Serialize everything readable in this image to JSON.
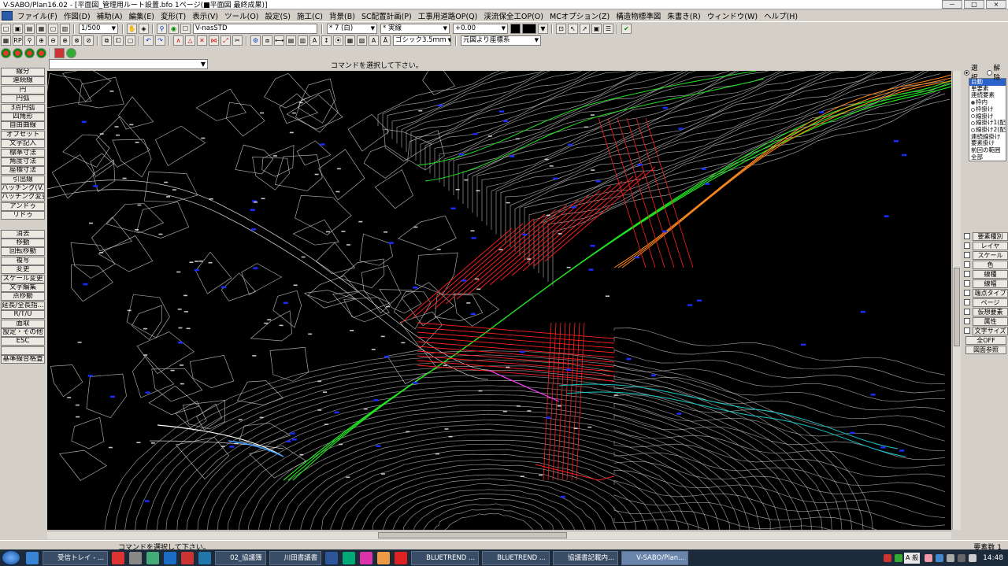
{
  "window": {
    "title": "V-SABO/Plan16.02 - [平面図_管理用ルート設置.bfo 1ページ(■平面図 最終成果)]",
    "controls": [
      "－",
      "□",
      "×"
    ]
  },
  "menubar": {
    "items": [
      "ファイル(F)",
      "作図(D)",
      "補助(A)",
      "編集(E)",
      "変形(T)",
      "表示(V)",
      "ツール(O)",
      "設定(S)",
      "施工(C)",
      "背景(B)",
      "SC配置計画(P)",
      "工事用道路OP(Q)",
      "渓流保全工OP(O)",
      "MCオプション(Z)",
      "構造物標準図",
      "朱書き(R)",
      "ウィンドウ(W)",
      "ヘルプ(H)"
    ]
  },
  "toolbar1": {
    "scale": "1/500",
    "layer_style": "V-nasSTD",
    "line_weight": "* 7 (白)",
    "line_type": "* 実線",
    "offset": "+0.00"
  },
  "toolbar2": {
    "font": "ゴシック3.5ｍｍ",
    "coordinate_system": "元図より座標系"
  },
  "command_bar": {
    "combo_value": "",
    "message": "コマンドを選択して下さい。"
  },
  "left_tools": {
    "group1": [
      "線分",
      "連続線",
      "円",
      "円弧",
      "3点円弧",
      "四角形",
      "自由曲線",
      "オフセット",
      "文字記入",
      "標準寸法",
      "角度寸法",
      "座標寸法",
      "引出線",
      "ハッチング(V...",
      "ハッチング変更",
      "アンドゥ",
      "リドゥ"
    ],
    "group2": [
      "消去",
      "移動",
      "回転移動",
      "複写",
      "変更",
      "スケール変更",
      "文字編集",
      "点移動",
      "延長/全長指...",
      "R/T/U",
      "面取",
      "設定・その他",
      "ESC",
      "",
      "基準線合格査"
    ]
  },
  "right_panel": {
    "mode_options": [
      {
        "label": "選択",
        "checked": true
      },
      {
        "label": "解除",
        "checked": false
      }
    ],
    "select_items": [
      {
        "label": "自動",
        "highlight": true,
        "radio": null
      },
      {
        "label": "単要素",
        "highlight": false,
        "radio": null
      },
      {
        "label": "連続要素",
        "highlight": false,
        "radio": null
      },
      {
        "label": "枠内",
        "highlight": false,
        "radio": true
      },
      {
        "label": "枠掛け",
        "highlight": false,
        "radio": false
      },
      {
        "label": "線掛け",
        "highlight": false,
        "radio": false
      },
      {
        "label": "線掛け1(配置多",
        "highlight": false,
        "radio": false
      },
      {
        "label": "線掛け2(配置多",
        "highlight": false,
        "radio": false
      },
      {
        "label": "連続線掛け",
        "highlight": false,
        "radio": null
      },
      {
        "label": "要素掛け",
        "highlight": false,
        "radio": null
      },
      {
        "label": "前回の範囲",
        "highlight": false,
        "radio": null
      },
      {
        "label": "全部",
        "highlight": false,
        "radio": null
      }
    ],
    "attributes": [
      "要素種別",
      "レイヤ",
      "スケール",
      "色",
      "線種",
      "線幅",
      "端点タイプ",
      "ページ",
      "仮想要素",
      "属性",
      "文字サイズ"
    ],
    "buttons": [
      "全OFF",
      "図面参照"
    ]
  },
  "status": {
    "message": "コマンドを選択して下さい。",
    "count": "要素数  1"
  },
  "taskbar": {
    "tasks": [
      {
        "label": "受信トレイ - ...",
        "color": "#2a6ac7"
      },
      {
        "label": "02_協議簿",
        "color": "#e8c35a"
      },
      {
        "label": "川田書議書",
        "color": "#e8c35a"
      },
      {
        "label": "BLUETREND ...",
        "color": "#3f6fb5"
      },
      {
        "label": "BLUETREND ...",
        "color": "#3f6fb5"
      },
      {
        "label": "協議書記載内...",
        "color": "#2b579a"
      },
      {
        "label": "V-SABO/Plan...",
        "color": "#4a78c2"
      }
    ],
    "ime": "A 般",
    "clock": "14:48"
  },
  "colors": {
    "canvas_bg": "#000000",
    "contour": "#cfcfcf",
    "red_route": "#ff2020",
    "green_route": "#22e022",
    "blue_label": "#1a2cff",
    "orange_route": "#ff8a1e",
    "cyan_route": "#19c8c8",
    "magenta_route": "#ff3cff"
  }
}
